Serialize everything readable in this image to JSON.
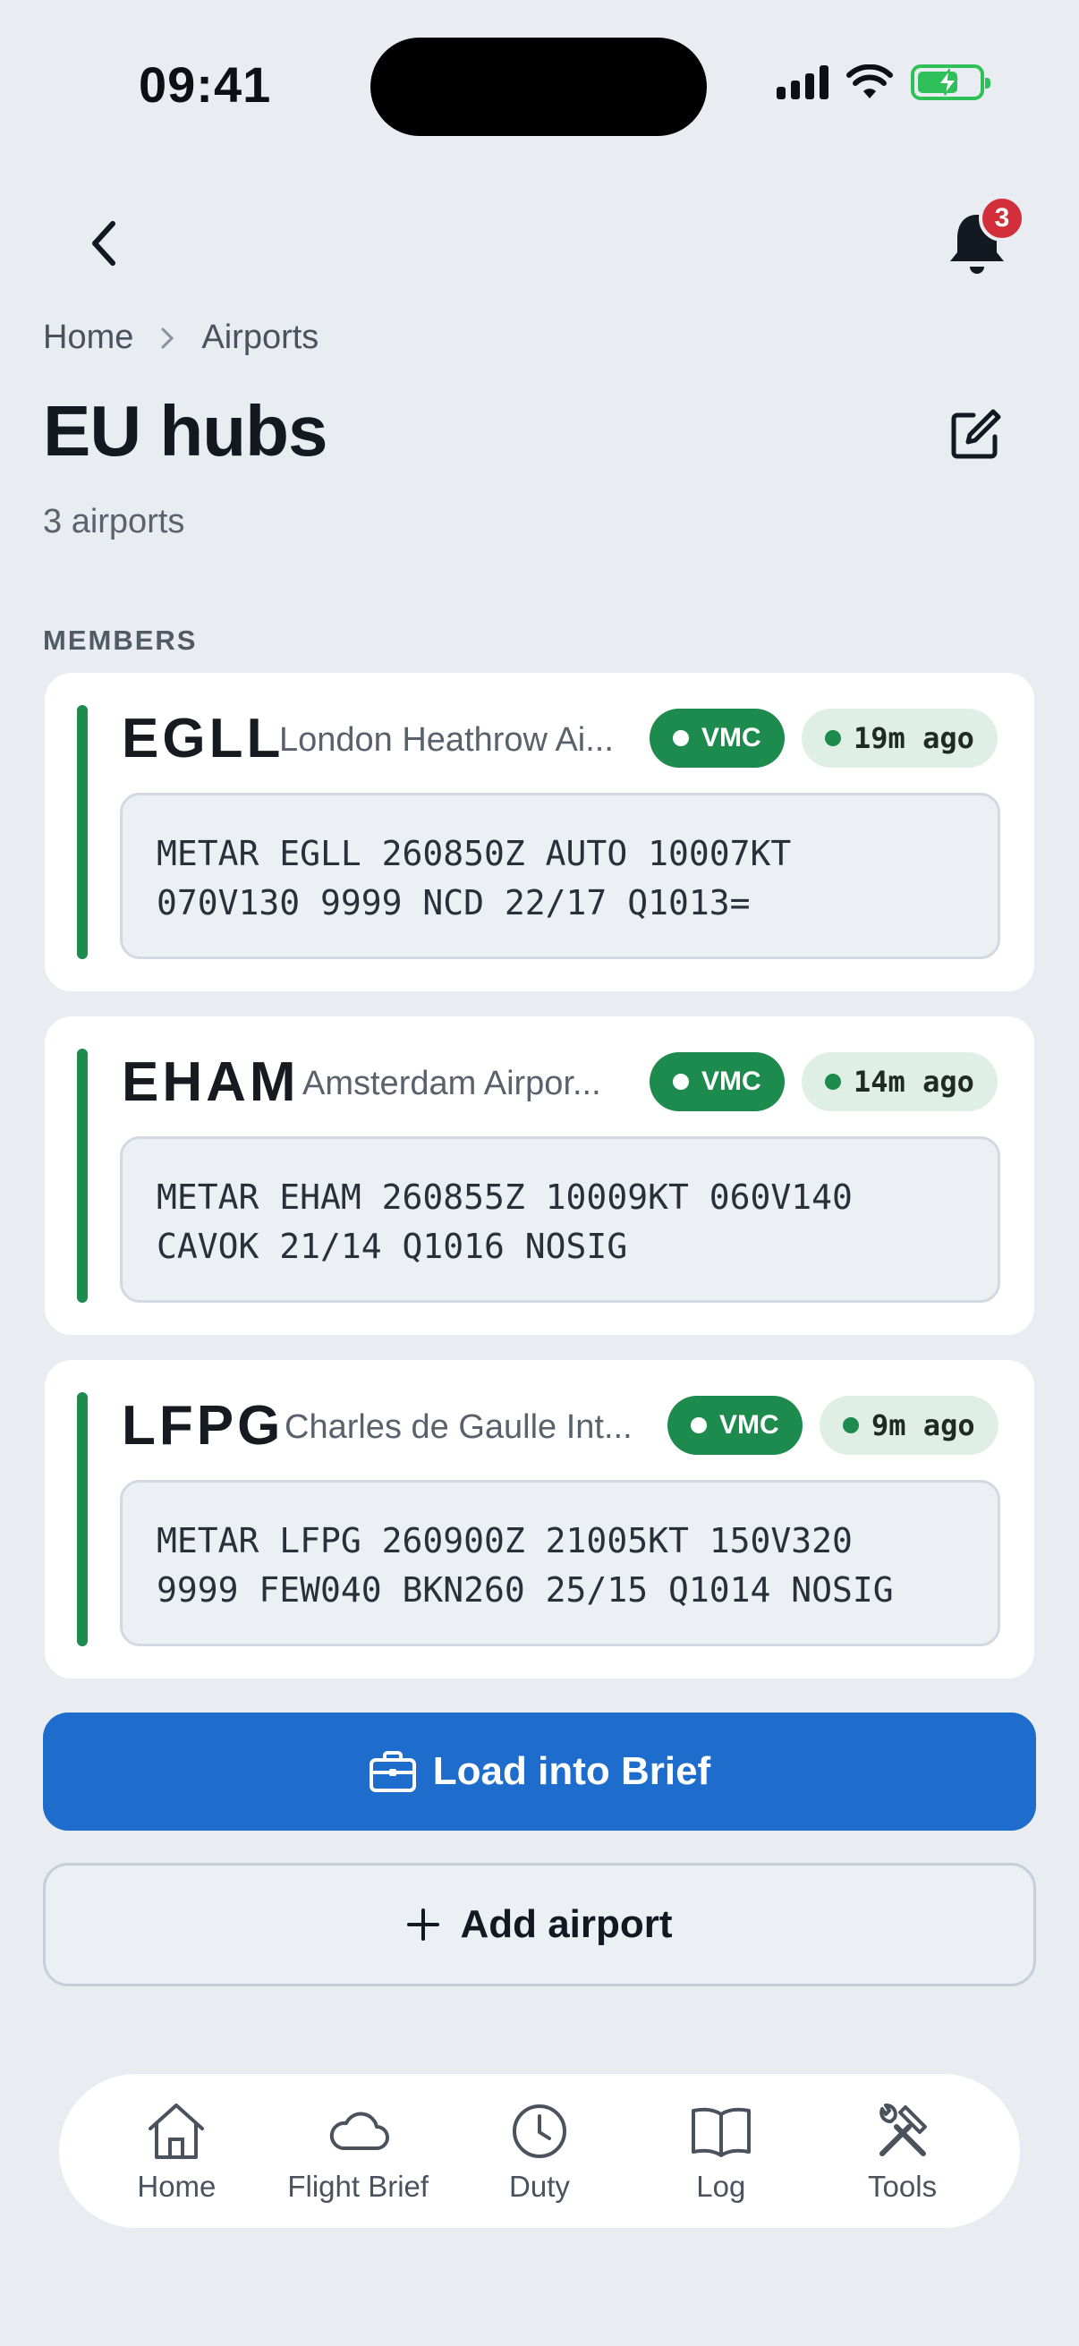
{
  "status_bar": {
    "time": "09:41"
  },
  "header": {
    "back_icon": "chevron-left-icon",
    "notifications_icon": "bell-icon",
    "notification_count": "3"
  },
  "breadcrumb": {
    "home": "Home",
    "current": "Airports"
  },
  "page": {
    "title": "EU hubs",
    "subtitle": "3 airports",
    "section_label": "MEMBERS",
    "edit_icon": "edit-icon"
  },
  "airports": [
    {
      "icao": "EGLL",
      "name": "London Heathrow Ai...",
      "category": "VMC",
      "age": "19m ago",
      "metar": "METAR EGLL 260850Z AUTO 10007KT\n070V130 9999 NCD 22/17 Q1013="
    },
    {
      "icao": "EHAM",
      "name": "Amsterdam Airpor...",
      "category": "VMC",
      "age": "14m ago",
      "metar": "METAR EHAM 260855Z 10009KT 060V140\nCAVOK 21/14 Q1016 NOSIG"
    },
    {
      "icao": "LFPG",
      "name": "Charles de Gaulle Int...",
      "category": "VMC",
      "age": "9m ago",
      "metar": "METAR LFPG 260900Z 21005KT 150V320\n9999 FEW040 BKN260 25/15 Q1014 NOSIG"
    }
  ],
  "actions": {
    "load_label": "Load into Brief",
    "add_label": "Add airport"
  },
  "tabs": [
    {
      "label": "Home",
      "icon": "home-icon"
    },
    {
      "label": "Flight Brief",
      "icon": "cloud-icon"
    },
    {
      "label": "Duty",
      "icon": "clock-icon"
    },
    {
      "label": "Log",
      "icon": "book-icon"
    },
    {
      "label": "Tools",
      "icon": "tools-icon"
    }
  ],
  "colors": {
    "vmc": "#1d8a4e",
    "primary": "#1e6ccb",
    "badge": "#d22f3a"
  }
}
